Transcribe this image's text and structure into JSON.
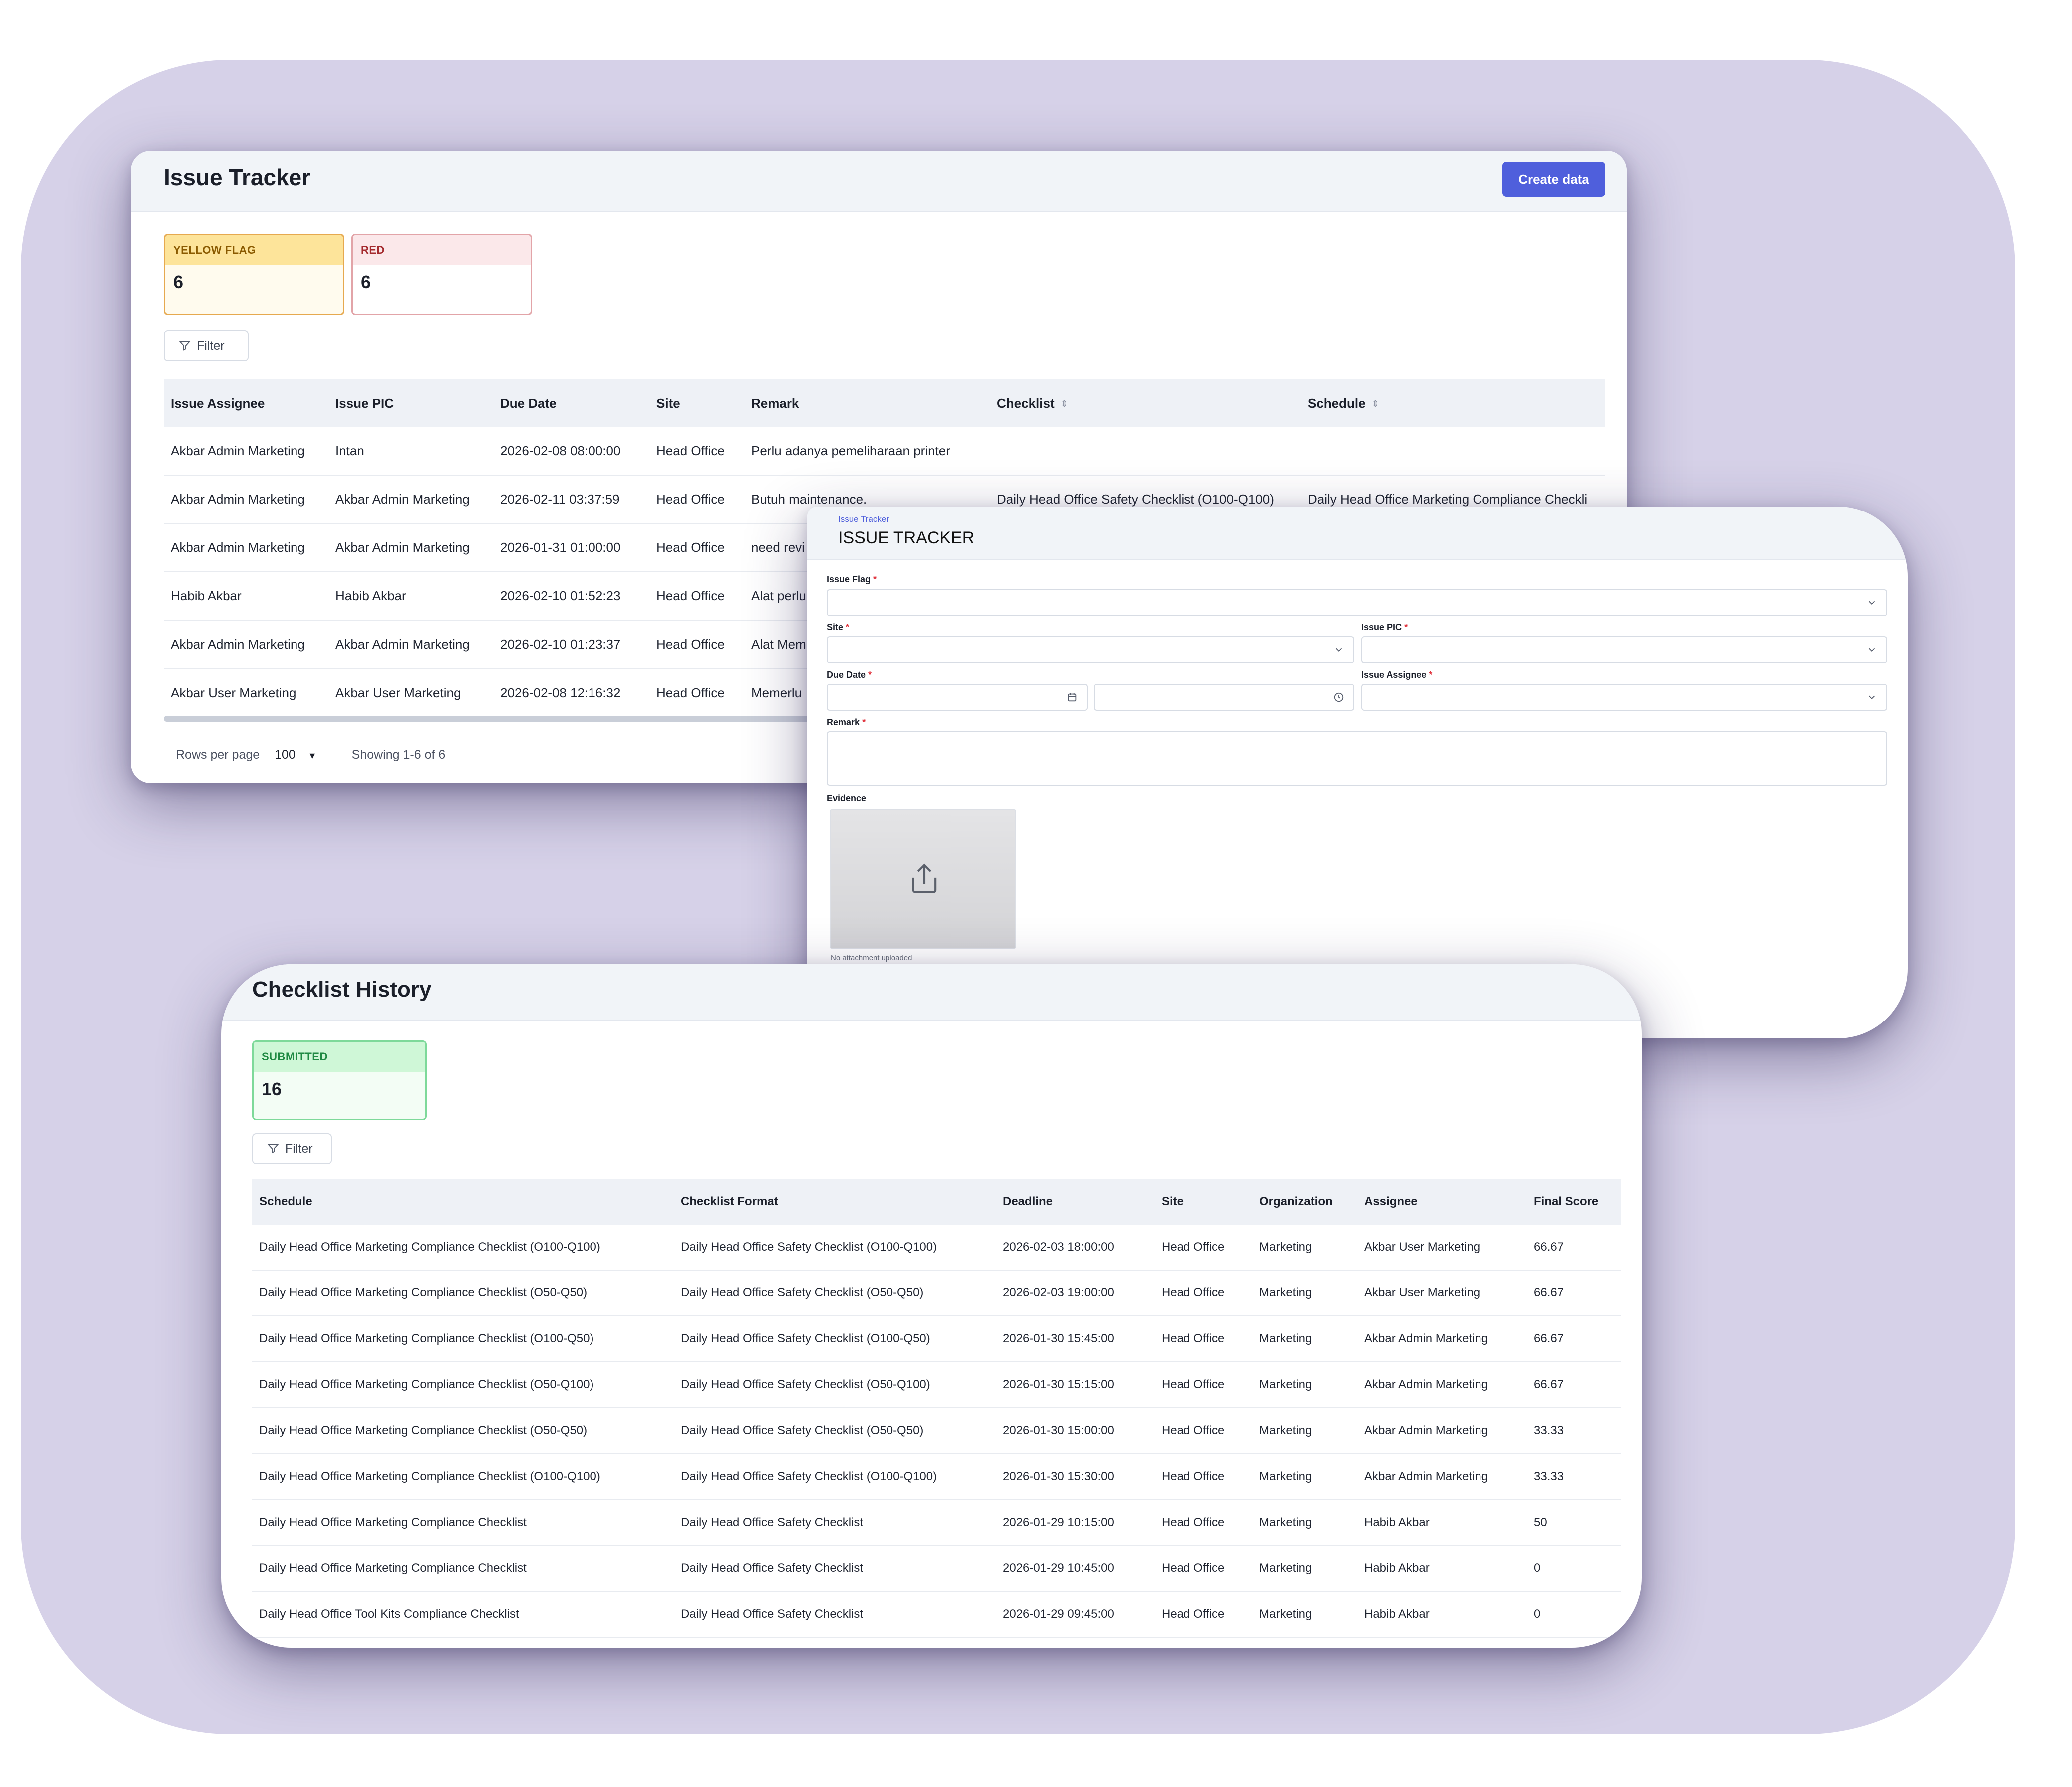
{
  "issue_tracker": {
    "title": "Issue Tracker",
    "create_label": "Create data",
    "tiles": [
      {
        "label": "YELLOW FLAG",
        "value": "6"
      },
      {
        "label": "RED",
        "value": "6"
      }
    ],
    "filter_label": "Filter",
    "columns": [
      "Issue Assignee",
      "Issue PIC",
      "Due Date",
      "Site",
      "Remark",
      "Checklist",
      "Schedule"
    ],
    "rows": [
      [
        "Akbar Admin Marketing",
        "Intan",
        "2026-02-08 08:00:00",
        "Head Office",
        "Perlu adanya pemeliharaan printer",
        "",
        ""
      ],
      [
        "Akbar Admin Marketing",
        "Akbar Admin Marketing",
        "2026-02-11 03:37:59",
        "Head Office",
        "Butuh maintenance.",
        "Daily Head Office Safety Checklist (O100-Q100)",
        "Daily Head Office Marketing Compliance Checkli"
      ],
      [
        "Akbar Admin Marketing",
        "Akbar Admin Marketing",
        "2026-01-31 01:00:00",
        "Head Office",
        "need revi",
        "",
        ""
      ],
      [
        "Habib Akbar",
        "Habib Akbar",
        "2026-02-10 01:52:23",
        "Head Office",
        "Alat perlu",
        "",
        ""
      ],
      [
        "Akbar Admin Marketing",
        "Akbar Admin Marketing",
        "2026-02-10 01:23:37",
        "Head Office",
        "Alat Mem",
        "",
        ""
      ],
      [
        "Akbar User Marketing",
        "Akbar User Marketing",
        "2026-02-08 12:16:32",
        "Head Office",
        "Memerlu",
        "",
        ""
      ]
    ],
    "pager": {
      "rows_per_page_label": "Rows per page",
      "rows_per_page": "100",
      "showing": "Showing 1-6 of 6"
    }
  },
  "issue_form": {
    "breadcrumb": "Issue Tracker",
    "title": "ISSUE TRACKER",
    "fields": {
      "issue_flag": "Issue Flag",
      "site": "Site",
      "issue_pic": "Issue PIC",
      "due_date": "Due Date",
      "issue_assignee": "Issue Assignee",
      "remark": "Remark",
      "evidence": "Evidence"
    },
    "required_mark": "*",
    "no_attachment": "No attachment uploaded"
  },
  "checklist_history": {
    "title": "Checklist History",
    "tile": {
      "label": "SUBMITTED",
      "value": "16"
    },
    "filter_label": "Filter",
    "columns": [
      "Schedule",
      "Checklist Format",
      "Deadline",
      "Site",
      "Organization",
      "Assignee",
      "Final Score"
    ],
    "rows": [
      [
        "Daily Head Office Marketing Compliance Checklist (O100-Q100)",
        "Daily Head Office Safety Checklist (O100-Q100)",
        "2026-02-03 18:00:00",
        "Head Office",
        "Marketing",
        "Akbar User Marketing",
        "66.67"
      ],
      [
        "Daily Head Office Marketing Compliance Checklist (O50-Q50)",
        "Daily Head Office Safety Checklist (O50-Q50)",
        "2026-02-03 19:00:00",
        "Head Office",
        "Marketing",
        "Akbar User Marketing",
        "66.67"
      ],
      [
        "Daily Head Office Marketing Compliance Checklist (O100-Q50)",
        "Daily Head Office Safety Checklist (O100-Q50)",
        "2026-01-30 15:45:00",
        "Head Office",
        "Marketing",
        "Akbar Admin Marketing",
        "66.67"
      ],
      [
        "Daily Head Office Marketing Compliance Checklist (O50-Q100)",
        "Daily Head Office Safety Checklist (O50-Q100)",
        "2026-01-30 15:15:00",
        "Head Office",
        "Marketing",
        "Akbar Admin Marketing",
        "66.67"
      ],
      [
        "Daily Head Office Marketing Compliance Checklist (O50-Q50)",
        "Daily Head Office Safety Checklist (O50-Q50)",
        "2026-01-30 15:00:00",
        "Head Office",
        "Marketing",
        "Akbar Admin Marketing",
        "33.33"
      ],
      [
        "Daily Head Office Marketing Compliance Checklist (O100-Q100)",
        "Daily Head Office Safety Checklist (O100-Q100)",
        "2026-01-30 15:30:00",
        "Head Office",
        "Marketing",
        "Akbar Admin Marketing",
        "33.33"
      ],
      [
        "Daily Head Office Marketing Compliance Checklist",
        "Daily Head Office Safety Checklist",
        "2026-01-29 10:15:00",
        "Head Office",
        "Marketing",
        "Habib Akbar",
        "50"
      ],
      [
        "Daily Head Office Marketing Compliance Checklist",
        "Daily Head Office Safety Checklist",
        "2026-01-29 10:45:00",
        "Head Office",
        "Marketing",
        "Habib Akbar",
        "0"
      ],
      [
        "Daily Head Office Tool Kits Compliance Checklist",
        "Daily Head Office Safety Checklist",
        "2026-01-29 09:45:00",
        "Head Office",
        "Marketing",
        "Habib Akbar",
        "0"
      ]
    ]
  },
  "icons": {
    "filter": "filter-icon",
    "sort": "sort-icon",
    "chevron": "chevron-down-icon",
    "calendar": "calendar-icon",
    "clock": "clock-icon",
    "upload": "upload-icon"
  },
  "colors": {
    "backdrop": "#d6d1e8",
    "accent": "#4f5fdc",
    "header_bg": "#f1f4f8"
  }
}
